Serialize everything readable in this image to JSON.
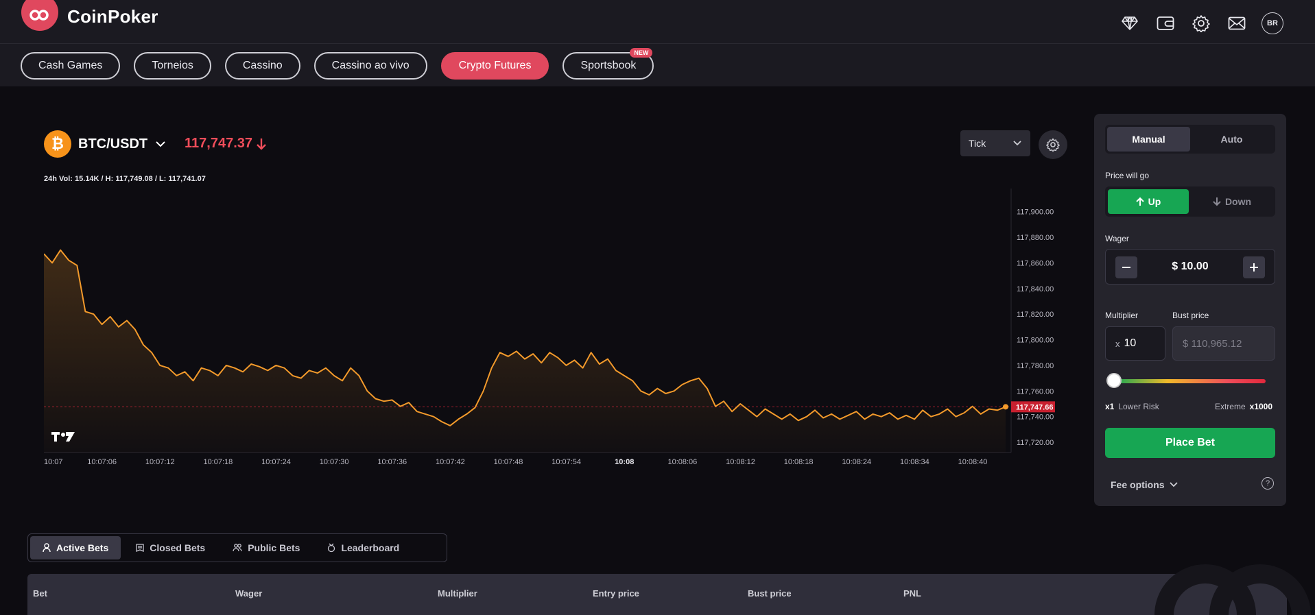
{
  "brand": {
    "name": "CoinPoker",
    "accent": "#e0485e"
  },
  "header_icons": [
    "diamond-icon",
    "wallet-icon",
    "gear-icon",
    "mail-icon"
  ],
  "header": {
    "locale_badge": "BR"
  },
  "nav": {
    "tabs": [
      {
        "label": "Cash Games"
      },
      {
        "label": "Torneios"
      },
      {
        "label": "Cassino"
      },
      {
        "label": "Cassino ao vivo"
      },
      {
        "label": "Crypto Futures",
        "active": true
      },
      {
        "label": "Sportsbook",
        "badge": "NEW"
      }
    ]
  },
  "market": {
    "pair": "BTC/USDT",
    "price": "117,747.37",
    "direction": "down",
    "stats": "24h Vol: 15.14K / H: 117,749.08 / L: 117,741.07",
    "interval": "Tick",
    "colors": {
      "down": "#ef4d5a",
      "up": "#17a653",
      "line": "#f39a2b"
    }
  },
  "chart_data": {
    "type": "line",
    "series": [
      {
        "values": [
          117867,
          117860,
          117870,
          117862,
          117858,
          117822,
          117820,
          117812,
          117818,
          117810,
          117815,
          117808,
          117796,
          117790,
          117780,
          117778,
          117772,
          117775,
          117768,
          117778,
          117776,
          117772,
          117780,
          117778,
          117775,
          117781,
          117779,
          117776,
          117780,
          117778,
          117772,
          117770,
          117776,
          117774,
          117778,
          117772,
          117768,
          117778,
          117772,
          117760,
          117754,
          117752,
          117753,
          117748,
          117751,
          117744,
          117742,
          117740,
          117736,
          117733,
          117738,
          117742,
          117747,
          117760,
          117778,
          117790,
          117787,
          117791,
          117785,
          117789,
          117782,
          117790,
          117786,
          117780,
          117784,
          117778,
          117790,
          117781,
          117785,
          117776,
          117772,
          117768,
          117760,
          117757,
          117762,
          117758,
          117760,
          117765,
          117768,
          117770,
          117762,
          117748,
          117752,
          117744,
          117750,
          117745,
          117740,
          117746,
          117742,
          117738,
          117742,
          117737,
          117740,
          117745,
          117739,
          117742,
          117738,
          117741,
          117744,
          117738,
          117742,
          117740,
          117743,
          117738,
          117741,
          117738,
          117745,
          117740,
          117742,
          117746,
          117740,
          117743,
          117748,
          117742,
          117746,
          117745,
          117747.66
        ]
      }
    ],
    "x_ticks": [
      "10:07",
      "10:07:06",
      "10:07:12",
      "10:07:18",
      "10:07:24",
      "10:07:30",
      "10:07:36",
      "10:07:42",
      "10:07:48",
      "10:07:54",
      "10:08",
      "10:08:06",
      "10:08:12",
      "10:08:18",
      "10:08:24",
      "10:08:34",
      "10:08:40"
    ],
    "y_ticks": [
      "117,900.00",
      "117,880.00",
      "117,860.00",
      "117,840.00",
      "117,820.00",
      "117,800.00",
      "117,780.00",
      "117,760.00",
      "117,740.00",
      "117,720.00"
    ],
    "ylim": [
      117712,
      117918
    ],
    "last_value": 117747.66,
    "last_label": "117,747.66",
    "watermark": "TV"
  },
  "panel": {
    "modes": [
      "Manual",
      "Auto"
    ],
    "direction_label": "Price will go",
    "up_label": "Up",
    "down_label": "Down",
    "wager_label": "Wager",
    "wager_value": "$ 10.00",
    "multiplier_label": "Multiplier",
    "bust_label": "Bust price",
    "multiplier_prefix": "x",
    "multiplier_value": "10",
    "bust_value": "$ 110,965.12",
    "slider_level": 0.01,
    "min_mult": "x1",
    "min_label": "Lower Risk",
    "max_label": "Extreme",
    "max_mult": "x1000",
    "place_bet": "Place Bet",
    "fee_options": "Fee options",
    "help": "?"
  },
  "bets": {
    "tabs": [
      "Active Bets",
      "Closed Bets",
      "Public Bets",
      "Leaderboard"
    ],
    "columns": [
      "Bet",
      "Wager",
      "Multiplier",
      "Entry price",
      "Bust price",
      "PNL"
    ]
  }
}
